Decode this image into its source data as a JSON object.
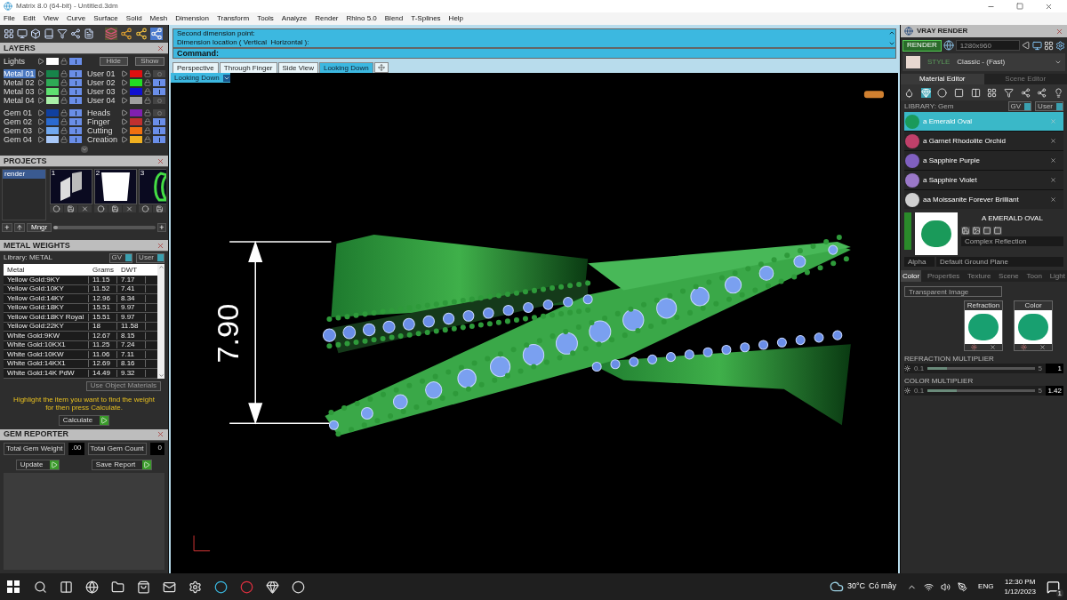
{
  "window": {
    "title": "Matrix 8.0 (64-bit) - Untitled.3dm"
  },
  "menu": [
    "File",
    "Edit",
    "View",
    "Curve",
    "Surface",
    "Solid",
    "Mesh",
    "Dimension",
    "Transform",
    "Tools",
    "Analyze",
    "Render",
    "Rhino 5.0",
    "Blend",
    "T-Splines",
    "Help"
  ],
  "layers": {
    "title": "LAYERS",
    "lights": {
      "name": "Lights",
      "color": "#ffffff",
      "selected": false,
      "visible": true
    },
    "hide_button": "Hide",
    "show_button": "Show",
    "groups": [
      {
        "rows": [
          {
            "left": {
              "name": "Metal 01",
              "color": "#17844a",
              "selected": true,
              "visible": true
            },
            "right": {
              "name": "User 01",
              "color": "#e01010",
              "selected": false,
              "visible": false
            }
          },
          {
            "left": {
              "name": "Metal 02",
              "color": "#2eaa55",
              "selected": false,
              "visible": true
            },
            "right": {
              "name": "User 02",
              "color": "#22dd22",
              "selected": false,
              "visible": true
            }
          },
          {
            "left": {
              "name": "Metal 03",
              "color": "#5ee070",
              "selected": false,
              "visible": true
            },
            "right": {
              "name": "User 03",
              "color": "#1010d0",
              "selected": false,
              "visible": true
            }
          },
          {
            "left": {
              "name": "Metal 04",
              "color": "#aaf0a8",
              "selected": false,
              "visible": true
            },
            "right": {
              "name": "User 04",
              "color": "#a0a0a0",
              "selected": false,
              "visible": false
            }
          }
        ]
      },
      {
        "rows": [
          {
            "left": {
              "name": "Gem 01",
              "color": "#1040a0",
              "selected": false,
              "visible": true
            },
            "right": {
              "name": "Heads",
              "color": "#8020b0",
              "selected": false,
              "visible": false
            }
          },
          {
            "left": {
              "name": "Gem 02",
              "color": "#2a6ad0",
              "selected": false,
              "visible": true
            },
            "right": {
              "name": "Finger",
              "color": "#c03030",
              "selected": false,
              "visible": true
            }
          },
          {
            "left": {
              "name": "Gem 03",
              "color": "#70a8f0",
              "selected": false,
              "visible": true
            },
            "right": {
              "name": "Cutting",
              "color": "#f07010",
              "selected": false,
              "visible": true
            }
          },
          {
            "left": {
              "name": "Gem 04",
              "color": "#a8c8f8",
              "selected": false,
              "visible": true
            },
            "right": {
              "name": "Creation",
              "color": "#f0b020",
              "selected": false,
              "visible": true
            }
          }
        ]
      }
    ]
  },
  "projects": {
    "title": "PROJECTS",
    "items": [
      {
        "label": "render",
        "selected": true
      }
    ],
    "thumbnails": [
      {
        "number": "1",
        "kind": "panels"
      },
      {
        "number": "2",
        "kind": "block"
      },
      {
        "number": "3",
        "kind": "ring"
      }
    ],
    "add_button": "+",
    "manager_button": "Mngr",
    "zoom_button": "+",
    "zoom_slider": {
      "level": 0.04
    }
  },
  "metal_weights": {
    "title": "METAL WEIGHTS",
    "library_label": "Library: METAL",
    "toggles": [
      "GV",
      "User"
    ],
    "columns": [
      "Metal",
      "Grams",
      "DWT"
    ],
    "rows": [
      [
        "Yellow Gold:9KY",
        "11.15",
        "7.17"
      ],
      [
        "Yellow Gold:10KY",
        "11.52",
        "7.41"
      ],
      [
        "Yellow Gold:14KY",
        "12.96",
        "8.34"
      ],
      [
        "Yellow Gold:18KY",
        "15.51",
        "9.97"
      ],
      [
        "Yellow Gold:18KY Royal",
        "15.51",
        "9.97"
      ],
      [
        "Yellow Gold:22KY",
        "18",
        "11.58"
      ],
      [
        "White Gold:9KW",
        "12.67",
        "8.15"
      ],
      [
        "White Gold:10KX1",
        "11.25",
        "7.24"
      ],
      [
        "White Gold:10KW",
        "11.06",
        "7.11"
      ],
      [
        "White Gold:14KX1",
        "12.69",
        "8.16"
      ],
      [
        "White Gold:14K PdW",
        "14.49",
        "9.32"
      ]
    ],
    "materials_button": "Use Object Materials",
    "hint": "Highlight the item you want to find the weight for then press Calculate.",
    "calculate_button": "Calculate"
  },
  "gem_reporter": {
    "title": "GEM REPORTER",
    "weight_label": "Total Gem Weight",
    "weight_value": ".00",
    "count_label": "Total Gem Count",
    "count_value": "0",
    "update_button": "Update",
    "save_button": "Save Report"
  },
  "command": {
    "history": [
      "Second dimension point:",
      "Dimension location ( Vertical  Horizontal ):"
    ],
    "prompt": "Command:"
  },
  "viewport_tabs": [
    {
      "label": "Perspective",
      "selected": false
    },
    {
      "label": "Through Finger",
      "selected": false
    },
    {
      "label": "Side View",
      "selected": false
    },
    {
      "label": "Looking Down",
      "selected": true
    }
  ],
  "viewport": {
    "label": "Looking Down",
    "dimension": "7.90"
  },
  "vray": {
    "title": "VRAY RENDER",
    "render_button": "RENDER",
    "resolution": "1280x960",
    "style_label": "STYLE",
    "style_value": "Classic - (Fast)",
    "editor_tabs": [
      {
        "label": "Material Editor",
        "selected": true
      },
      {
        "label": "Scene Editor",
        "selected": false
      }
    ],
    "library_label": "LIBRARY: Gem",
    "toggles": [
      "GV",
      "User"
    ],
    "materials": [
      {
        "name": "a Emerald Oval",
        "color": "#1a9a5a",
        "selected": true
      },
      {
        "name": "a Garnet Rhodolite Orchid",
        "color": "#c0406a",
        "selected": false
      },
      {
        "name": "a Sapphire Purple",
        "color": "#8060c0",
        "selected": false
      },
      {
        "name": "a Sapphire Violet",
        "color": "#9a78c8",
        "selected": false
      },
      {
        "name": "aa Moissanite Forever Brilliant",
        "color": "#d0d0d0",
        "selected": false
      }
    ],
    "preview_name": "A EMERALD OVAL",
    "shader": "Complex Reflection",
    "alpha_label": "Alpha",
    "ground": "Default Ground Plane",
    "property_tabs": [
      {
        "label": "Color",
        "selected": true
      },
      {
        "label": "Properties",
        "selected": false
      },
      {
        "label": "Texture",
        "selected": false
      },
      {
        "label": "Scene",
        "selected": false
      },
      {
        "label": "Toon",
        "selected": false
      },
      {
        "label": "Light",
        "selected": false
      }
    ],
    "image_type": "Transparent Image",
    "swatches": [
      "Refraction",
      "Color"
    ],
    "sliders": [
      {
        "label": "REFRACTION MULTIPLIER",
        "min": "0.1",
        "max": "5",
        "level": 0.18,
        "value": "1"
      },
      {
        "label": "COLOR MULTIPLIER",
        "min": "0.1",
        "max": "5",
        "level": 0.27,
        "value": "1.42"
      }
    ]
  },
  "taskbar": {
    "temperature": "30°C",
    "weather": "Có mây",
    "language": "ENG",
    "time": "12:30 PM",
    "date": "1/12/2023",
    "notifications": "1"
  }
}
